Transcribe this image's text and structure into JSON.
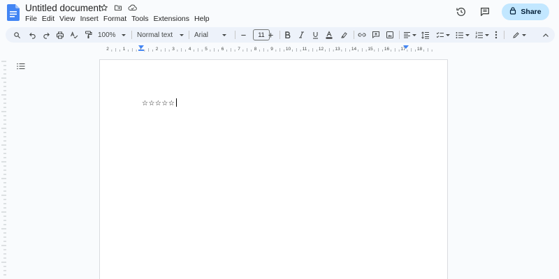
{
  "app": {
    "title": "Untitled document",
    "menu": [
      "File",
      "Edit",
      "View",
      "Insert",
      "Format",
      "Tools",
      "Extensions",
      "Help"
    ],
    "share_label": "Share",
    "accent_color": "#c2e7ff"
  },
  "toolbar": {
    "zoom": "100%",
    "style": "Normal text",
    "font": "Arial",
    "font_size": "11"
  },
  "document": {
    "text": "☆☆☆☆☆"
  },
  "ruler": {
    "ticks": [
      "2",
      "1",
      "1",
      "2",
      "3",
      "4",
      "5",
      "6",
      "7",
      "8",
      "9",
      "10",
      "11",
      "12",
      "13",
      "14",
      "15",
      "16",
      "17",
      "18"
    ]
  },
  "icons": {
    "title_row": [
      "star-icon",
      "move-folder-icon",
      "cloud-saved-icon"
    ],
    "right": [
      "version-history-icon",
      "comments-icon",
      "lock-icon"
    ]
  }
}
